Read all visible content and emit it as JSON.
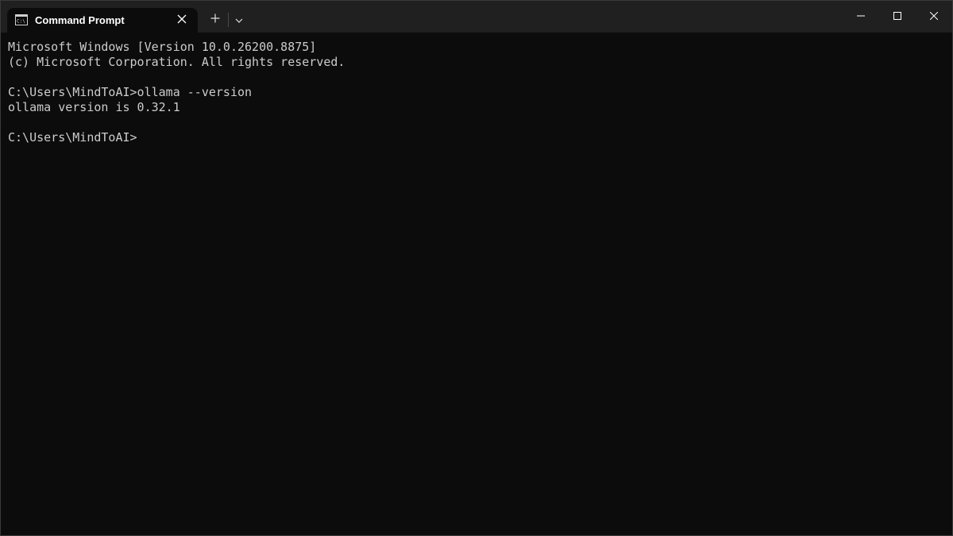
{
  "window": {
    "tab": {
      "icon": "command-prompt-icon",
      "title": "Command Prompt",
      "close_icon": "close-icon"
    },
    "new_tab_icon": "plus-icon",
    "dropdown_icon": "chevron-down-icon",
    "controls": {
      "minimize_icon": "minimize-icon",
      "maximize_icon": "maximize-icon",
      "close_icon": "close-icon"
    }
  },
  "terminal": {
    "lines": [
      "Microsoft Windows [Version 10.0.26200.8875]",
      "(c) Microsoft Corporation. All rights reserved.",
      "",
      "C:\\Users\\MindToAI>ollama --version",
      "ollama version is 0.32.1",
      "",
      "C:\\Users\\MindToAI>"
    ]
  },
  "colors": {
    "titlebar_bg": "#202020",
    "tab_bg": "#0c0c0c",
    "terminal_bg": "#0c0c0c",
    "terminal_text": "#cccccc"
  }
}
